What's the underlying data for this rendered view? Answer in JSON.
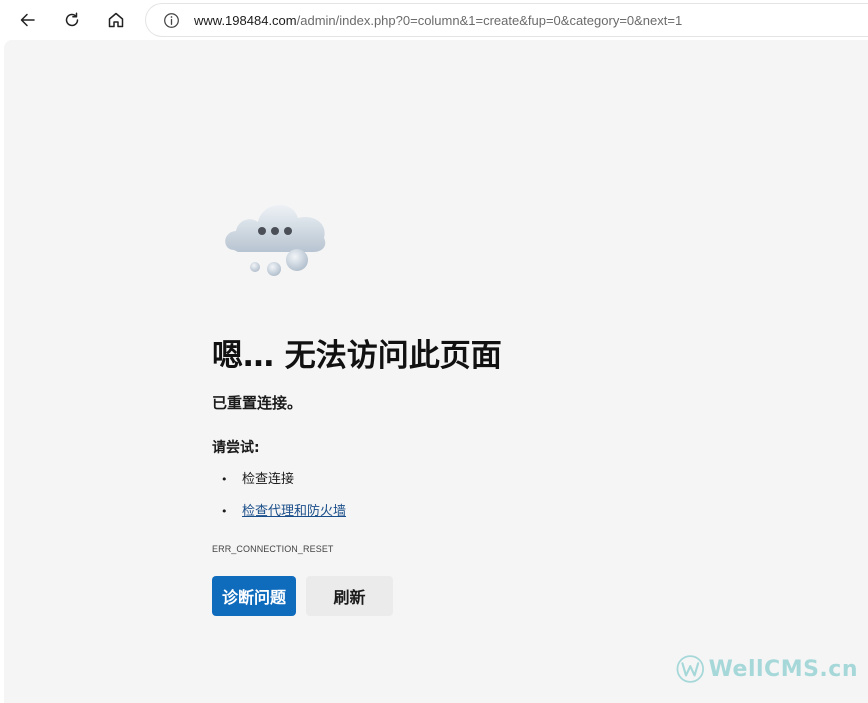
{
  "browser": {
    "url_host": "www.198484.com",
    "url_path": "/admin/index.php?0=column&1=create&fup=0&category=0&next=1"
  },
  "error_page": {
    "title": "嗯… 无法访问此页面",
    "message": "已重置连接。",
    "try_heading": "请尝试:",
    "suggestions": [
      {
        "label": "检查连接",
        "is_link": false
      },
      {
        "label": "检查代理和防火墙",
        "is_link": true
      }
    ],
    "error_code": "ERR_CONNECTION_RESET",
    "diagnose_button": "诊断问题",
    "refresh_button": "刷新"
  },
  "watermark": {
    "text": "WellCMS.cn"
  },
  "colors": {
    "primary_button": "#0f6cbd",
    "link": "#1a4e8a",
    "page_background": "#f5f5f5",
    "watermark": "#8ecfd0"
  },
  "icons": [
    "back-arrow-icon",
    "refresh-icon",
    "home-icon",
    "info-icon",
    "sad-cloud-illustration"
  ]
}
